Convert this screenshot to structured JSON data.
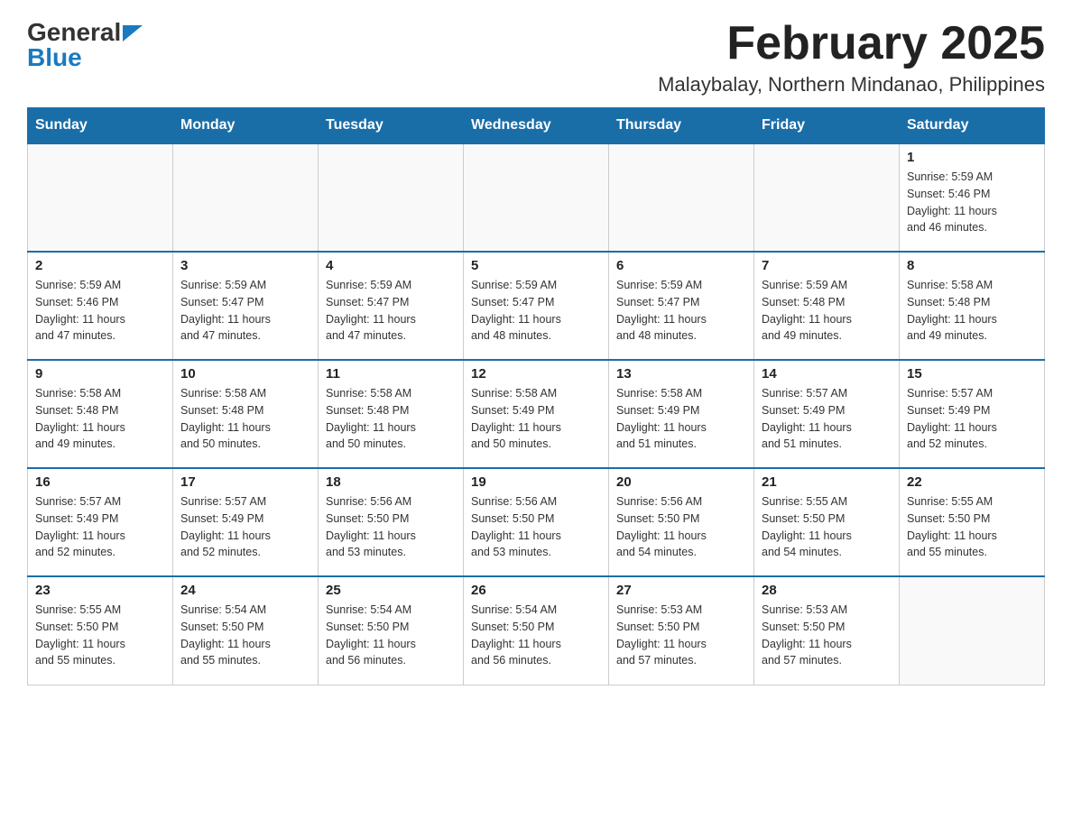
{
  "header": {
    "logo_text_black": "General",
    "logo_text_blue": "Blue",
    "month_title": "February 2025",
    "location": "Malaybalay, Northern Mindanao, Philippines"
  },
  "days_of_week": [
    "Sunday",
    "Monday",
    "Tuesday",
    "Wednesday",
    "Thursday",
    "Friday",
    "Saturday"
  ],
  "weeks": [
    {
      "days": [
        {
          "num": "",
          "info": ""
        },
        {
          "num": "",
          "info": ""
        },
        {
          "num": "",
          "info": ""
        },
        {
          "num": "",
          "info": ""
        },
        {
          "num": "",
          "info": ""
        },
        {
          "num": "",
          "info": ""
        },
        {
          "num": "1",
          "info": "Sunrise: 5:59 AM\nSunset: 5:46 PM\nDaylight: 11 hours\nand 46 minutes."
        }
      ]
    },
    {
      "days": [
        {
          "num": "2",
          "info": "Sunrise: 5:59 AM\nSunset: 5:46 PM\nDaylight: 11 hours\nand 47 minutes."
        },
        {
          "num": "3",
          "info": "Sunrise: 5:59 AM\nSunset: 5:47 PM\nDaylight: 11 hours\nand 47 minutes."
        },
        {
          "num": "4",
          "info": "Sunrise: 5:59 AM\nSunset: 5:47 PM\nDaylight: 11 hours\nand 47 minutes."
        },
        {
          "num": "5",
          "info": "Sunrise: 5:59 AM\nSunset: 5:47 PM\nDaylight: 11 hours\nand 48 minutes."
        },
        {
          "num": "6",
          "info": "Sunrise: 5:59 AM\nSunset: 5:47 PM\nDaylight: 11 hours\nand 48 minutes."
        },
        {
          "num": "7",
          "info": "Sunrise: 5:59 AM\nSunset: 5:48 PM\nDaylight: 11 hours\nand 49 minutes."
        },
        {
          "num": "8",
          "info": "Sunrise: 5:58 AM\nSunset: 5:48 PM\nDaylight: 11 hours\nand 49 minutes."
        }
      ]
    },
    {
      "days": [
        {
          "num": "9",
          "info": "Sunrise: 5:58 AM\nSunset: 5:48 PM\nDaylight: 11 hours\nand 49 minutes."
        },
        {
          "num": "10",
          "info": "Sunrise: 5:58 AM\nSunset: 5:48 PM\nDaylight: 11 hours\nand 50 minutes."
        },
        {
          "num": "11",
          "info": "Sunrise: 5:58 AM\nSunset: 5:48 PM\nDaylight: 11 hours\nand 50 minutes."
        },
        {
          "num": "12",
          "info": "Sunrise: 5:58 AM\nSunset: 5:49 PM\nDaylight: 11 hours\nand 50 minutes."
        },
        {
          "num": "13",
          "info": "Sunrise: 5:58 AM\nSunset: 5:49 PM\nDaylight: 11 hours\nand 51 minutes."
        },
        {
          "num": "14",
          "info": "Sunrise: 5:57 AM\nSunset: 5:49 PM\nDaylight: 11 hours\nand 51 minutes."
        },
        {
          "num": "15",
          "info": "Sunrise: 5:57 AM\nSunset: 5:49 PM\nDaylight: 11 hours\nand 52 minutes."
        }
      ]
    },
    {
      "days": [
        {
          "num": "16",
          "info": "Sunrise: 5:57 AM\nSunset: 5:49 PM\nDaylight: 11 hours\nand 52 minutes."
        },
        {
          "num": "17",
          "info": "Sunrise: 5:57 AM\nSunset: 5:49 PM\nDaylight: 11 hours\nand 52 minutes."
        },
        {
          "num": "18",
          "info": "Sunrise: 5:56 AM\nSunset: 5:50 PM\nDaylight: 11 hours\nand 53 minutes."
        },
        {
          "num": "19",
          "info": "Sunrise: 5:56 AM\nSunset: 5:50 PM\nDaylight: 11 hours\nand 53 minutes."
        },
        {
          "num": "20",
          "info": "Sunrise: 5:56 AM\nSunset: 5:50 PM\nDaylight: 11 hours\nand 54 minutes."
        },
        {
          "num": "21",
          "info": "Sunrise: 5:55 AM\nSunset: 5:50 PM\nDaylight: 11 hours\nand 54 minutes."
        },
        {
          "num": "22",
          "info": "Sunrise: 5:55 AM\nSunset: 5:50 PM\nDaylight: 11 hours\nand 55 minutes."
        }
      ]
    },
    {
      "days": [
        {
          "num": "23",
          "info": "Sunrise: 5:55 AM\nSunset: 5:50 PM\nDaylight: 11 hours\nand 55 minutes."
        },
        {
          "num": "24",
          "info": "Sunrise: 5:54 AM\nSunset: 5:50 PM\nDaylight: 11 hours\nand 55 minutes."
        },
        {
          "num": "25",
          "info": "Sunrise: 5:54 AM\nSunset: 5:50 PM\nDaylight: 11 hours\nand 56 minutes."
        },
        {
          "num": "26",
          "info": "Sunrise: 5:54 AM\nSunset: 5:50 PM\nDaylight: 11 hours\nand 56 minutes."
        },
        {
          "num": "27",
          "info": "Sunrise: 5:53 AM\nSunset: 5:50 PM\nDaylight: 11 hours\nand 57 minutes."
        },
        {
          "num": "28",
          "info": "Sunrise: 5:53 AM\nSunset: 5:50 PM\nDaylight: 11 hours\nand 57 minutes."
        },
        {
          "num": "",
          "info": ""
        }
      ]
    }
  ]
}
